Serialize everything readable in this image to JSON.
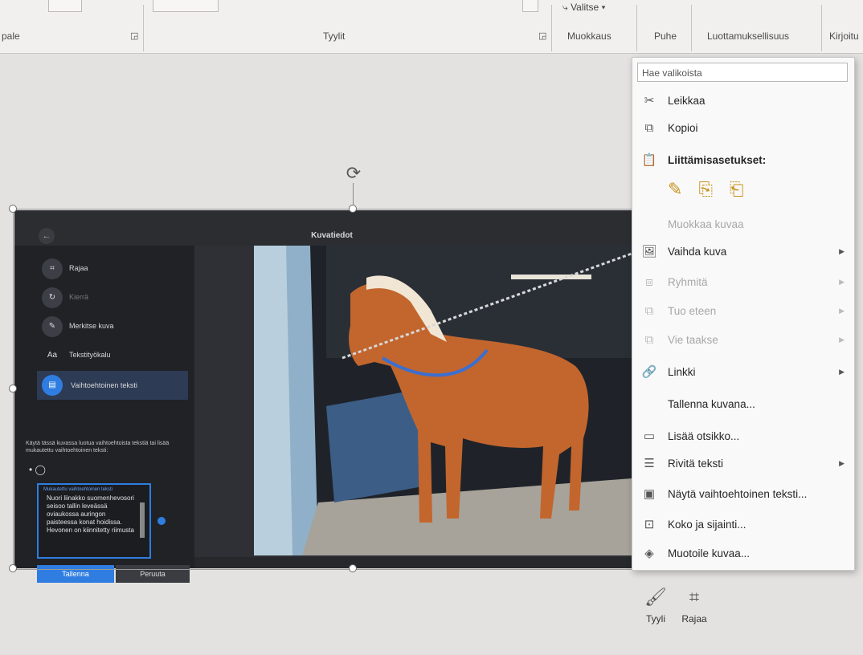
{
  "ribbon": {
    "groups": [
      "pale",
      "Tyylit",
      "Muokkaus",
      "Puhe",
      "Luottamuksellisuus",
      "Kirjoitu"
    ],
    "valitse": "Valitse"
  },
  "dialog": {
    "title": "Kuvatiedot",
    "tools": [
      "Rajaa",
      "Kierrä",
      "Merkitse kuva",
      "Tekstityökalu",
      "Vaihtoehtoinen teksti"
    ],
    "help": "Käytä tässä kuvassa luotua vaihtoehtoista tekstiä tai lisää mukautettu vaihtoehtoinen teksti:",
    "alt_label": "Mukautettu vaihtoehtoinen teksti",
    "alt_text": "Nuori liinakko suomenhevosori seisoo tallin leveässä oviaukossa auringon paisteessa konat hoidissa. Hevonen on kiinnitetty riimusta",
    "save": "Tallenna",
    "cancel": "Peruuta"
  },
  "menu": {
    "search_placeholder": "Hae valikoista",
    "cut": "Leikkaa",
    "copy": "Kopioi",
    "paste_options": "Liittämisasetukset:",
    "edit_picture": "Muokkaa kuvaa",
    "change_picture": "Vaihda kuva",
    "group": "Ryhmitä",
    "bring_forward": "Tuo eteen",
    "send_backward": "Vie taakse",
    "link": "Linkki",
    "save_as_picture": "Tallenna kuvana...",
    "insert_caption": "Lisää otsikko...",
    "wrap_text": "Rivitä teksti",
    "view_alt_text": "Näytä vaihtoehtoinen teksti...",
    "size_position": "Koko ja sijainti...",
    "format_picture": "Muotoile kuvaa..."
  },
  "mini_toolbar": {
    "style": "Tyyli",
    "crop": "Rajaa"
  },
  "colors": {
    "accent": "#2f7de1",
    "paste_icon": "#c9911d",
    "menu_bg": "#f9f9f9"
  }
}
